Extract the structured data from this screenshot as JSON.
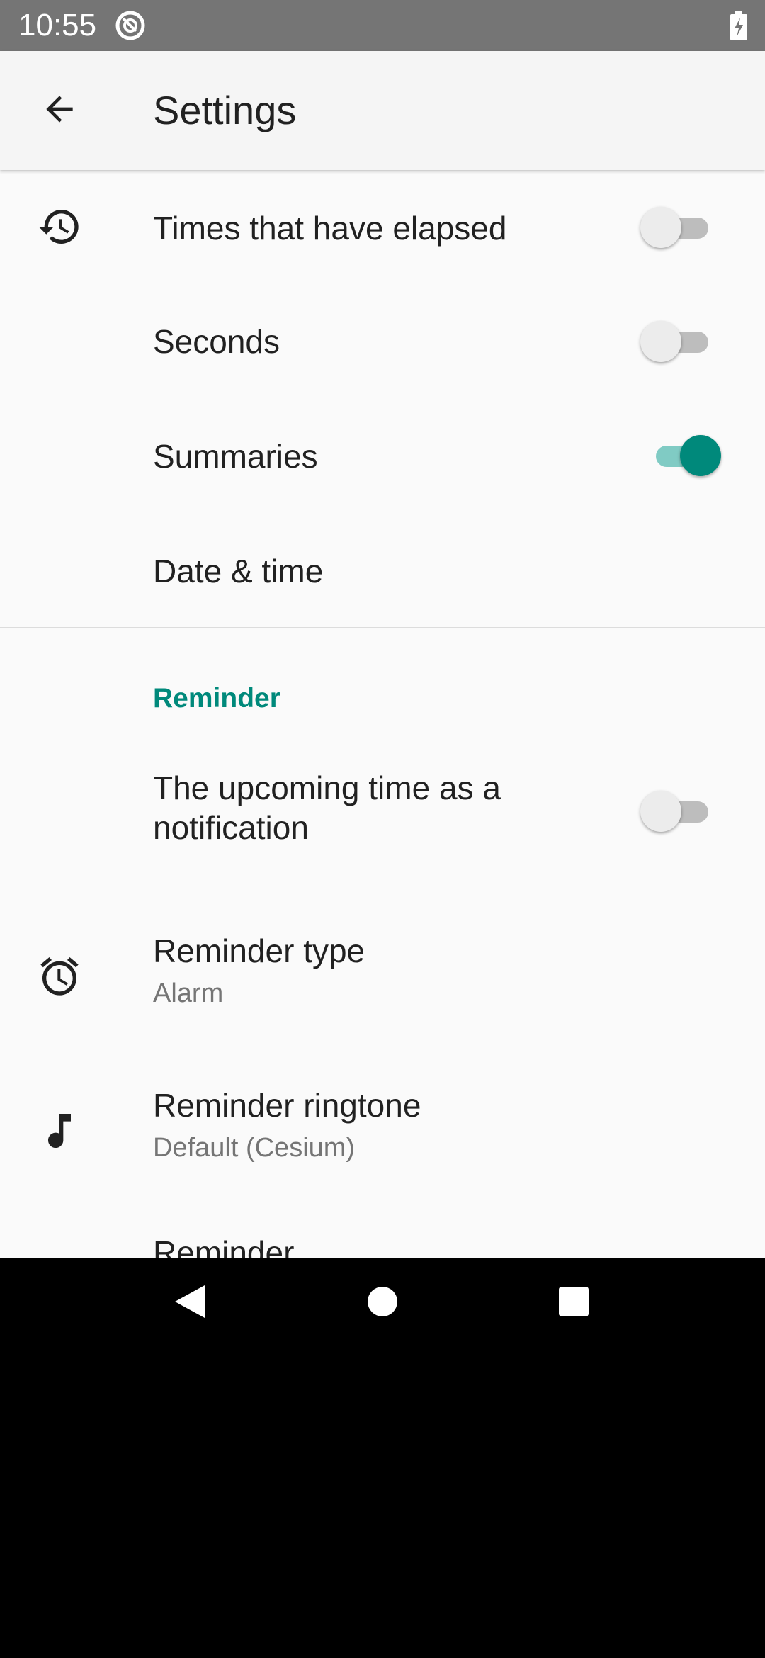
{
  "status_bar": {
    "time": "10:55",
    "app_icon": "at-sign-icon",
    "battery_icon": "battery-charging-icon"
  },
  "app_bar": {
    "back_icon": "arrow-back-icon",
    "title": "Settings"
  },
  "preferences": {
    "elapsed": {
      "icon": "history-icon",
      "title": "Times that have elapsed",
      "enabled": false
    },
    "seconds": {
      "title": "Seconds",
      "enabled": false
    },
    "summaries": {
      "title": "Summaries",
      "enabled": true
    },
    "date_time": {
      "title": "Date & time"
    }
  },
  "reminder_section": {
    "category_title": "Reminder",
    "notification": {
      "title": "The upcoming time as a notification",
      "enabled": false
    },
    "type": {
      "icon": "alarm-icon",
      "title": "Reminder type",
      "summary": "Alarm"
    },
    "ringtone": {
      "icon": "music-note-icon",
      "title": "Reminder ringtone",
      "summary": "Default (Cesium)"
    },
    "next_item_partial": {
      "title": "Reminder"
    }
  },
  "nav_bar": {
    "back": "nav-back-icon",
    "home": "nav-home-icon",
    "recents": "nav-recents-icon"
  },
  "colors": {
    "accent": "#00897b",
    "status_bar": "#757575",
    "app_bar": "#f5f5f5",
    "background": "#fafafa"
  }
}
